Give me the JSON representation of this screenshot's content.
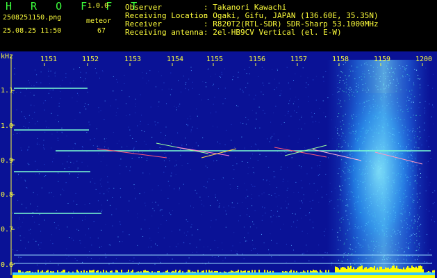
{
  "header": {
    "brand": "H R O F F T",
    "version": "1.0.0",
    "filename": "2508251150.png",
    "datetime": "25.08.25 11:50",
    "meteor_label": "meteor",
    "meteor_count": "67",
    "info": [
      {
        "label": "Observer",
        "value": ": Takanori Kawachi"
      },
      {
        "label": "Receiving Location",
        "value": ": Ogaki, Gifu, JAPAN (136.60E, 35.35N)"
      },
      {
        "label": "Receiver",
        "value": ": R820T2(RTL-SDR) SDR-Sharp 53.1000MHz"
      },
      {
        "label": "Receiving antenna",
        "value": ": 2el-HB9CV Vertical (el. E-W)"
      }
    ]
  },
  "plot": {
    "yunit": "kHz",
    "x_ticks": [
      "1151",
      "1152",
      "1153",
      "1154",
      "1155",
      "1156",
      "1157",
      "1158",
      "1159",
      "1200"
    ],
    "y_ticks": [
      "1.1",
      "1.0",
      "0.9",
      "0.8",
      "0.7",
      "0.6"
    ],
    "colors": {
      "background": "#0a1296",
      "ticks": "#ffff3c",
      "signal": "#7dffd2",
      "baseline": "#ffff00",
      "noise": "#33c8ff"
    }
  }
}
